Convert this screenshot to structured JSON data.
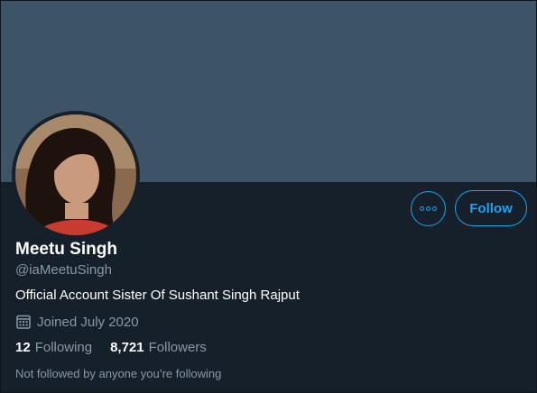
{
  "profile": {
    "name": "Meetu Singh",
    "handle": "@iaMeetuSingh",
    "bio": "Official Account Sister Of Sushant Singh Rajput",
    "joined": "Joined July 2020",
    "following_count": "12",
    "following_label": "Following",
    "followers_count": "8,721",
    "followers_label": "Followers",
    "not_followed_note": "Not followed by anyone you’re following"
  },
  "actions": {
    "follow_label": "Follow",
    "more_icon": "more-horizontal-icon"
  },
  "icons": {
    "joined_icon": "calendar-icon"
  },
  "colors": {
    "background": "#15202b",
    "banner": "#3d5466",
    "accent": "#1da1f2",
    "text_primary": "#ffffff",
    "text_secondary": "#8899a6"
  }
}
